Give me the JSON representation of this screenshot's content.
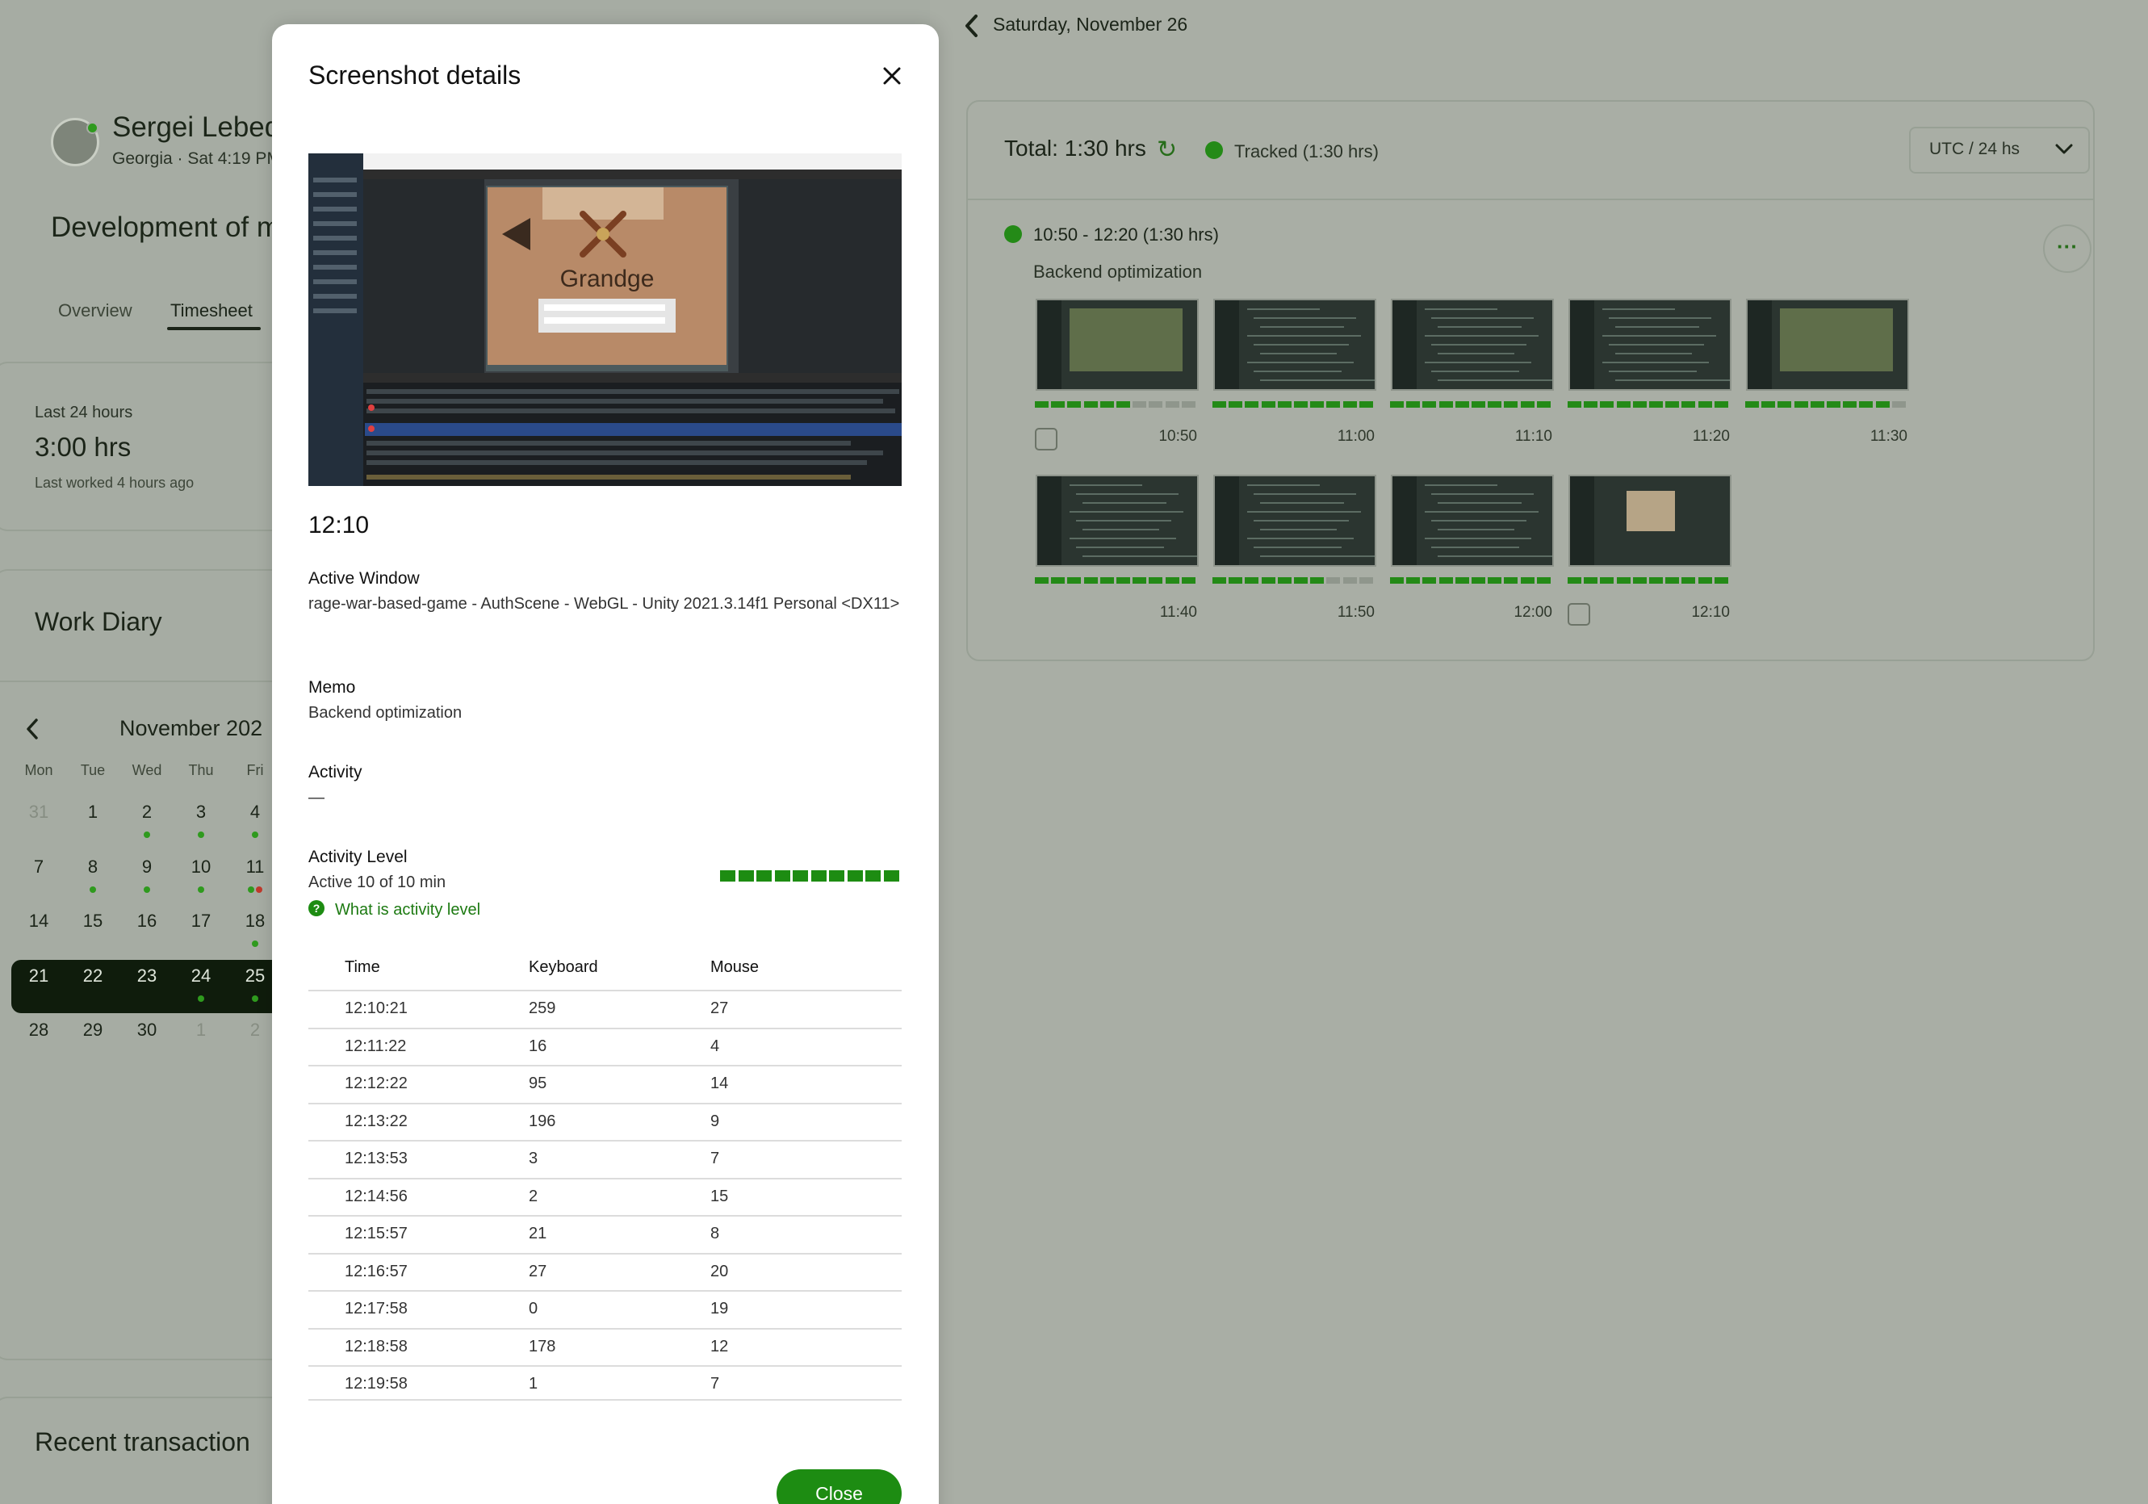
{
  "profile": {
    "name": "Sergei Lebed",
    "meta": "Georgia · Sat 4:19 PM",
    "contract_title": "Development of m"
  },
  "tabs": [
    "Overview",
    "Timesheet"
  ],
  "stats": {
    "label": "Last 24 hours",
    "value": "3:00 hrs",
    "sub": "Last worked 4 hours ago"
  },
  "diary": {
    "title": "Work Diary",
    "month": "November 202",
    "weekdays": [
      "Mon",
      "Tue",
      "Wed",
      "Thu",
      "Fri"
    ],
    "weeks": [
      [
        "31",
        "1",
        "2",
        "3",
        "4"
      ],
      [
        "7",
        "8",
        "9",
        "10",
        "11"
      ],
      [
        "14",
        "15",
        "16",
        "17",
        "18"
      ],
      [
        "21",
        "22",
        "23",
        "24",
        "25"
      ],
      [
        "28",
        "29",
        "30",
        "1",
        "2"
      ]
    ]
  },
  "recent_transactions": "Recent transaction",
  "day": {
    "title": "Saturday, November 26",
    "total": "Total: 1:30 hrs",
    "tracked": "Tracked (1:30 hrs)",
    "timezone": "UTC / 24 hs",
    "segment_time": "10:50 - 12:20 (1:30 hrs)",
    "segment_memo": "Backend optimization",
    "thumbnails": [
      {
        "time": "10:50",
        "activity": 6,
        "kind": "game"
      },
      {
        "time": "11:00",
        "activity": 10,
        "kind": "code"
      },
      {
        "time": "11:10",
        "activity": 10,
        "kind": "code"
      },
      {
        "time": "11:20",
        "activity": 10,
        "kind": "code"
      },
      {
        "time": "11:30",
        "activity": 9,
        "kind": "game"
      },
      {
        "time": "11:40",
        "activity": 10,
        "kind": "code"
      },
      {
        "time": "11:50",
        "activity": 7,
        "kind": "code"
      },
      {
        "time": "12:00",
        "activity": 10,
        "kind": "code"
      },
      {
        "time": "12:10",
        "activity": 10,
        "kind": "card"
      }
    ]
  },
  "modal": {
    "title": "Screenshot details",
    "shot_caption": "Grandge",
    "time": "12:10",
    "active_window_label": "Active Window",
    "active_window": "rage-war-based-game - AuthScene - WebGL - Unity 2021.3.14f1 Personal <DX11>",
    "memo_label": "Memo",
    "memo": "Backend optimization",
    "activity_label": "Activity",
    "activity": "—",
    "activity_level_label": "Activity Level",
    "activity_level": "Active 10 of 10 min",
    "activity_level_value": 10,
    "help_link": "What is activity level",
    "table": {
      "headers": [
        "Time",
        "Keyboard",
        "Mouse"
      ],
      "rows": [
        [
          "12:10:21",
          "259",
          "27"
        ],
        [
          "12:11:22",
          "16",
          "4"
        ],
        [
          "12:12:22",
          "95",
          "14"
        ],
        [
          "12:13:22",
          "196",
          "9"
        ],
        [
          "12:13:53",
          "3",
          "7"
        ],
        [
          "12:14:56",
          "2",
          "15"
        ],
        [
          "12:15:57",
          "21",
          "8"
        ],
        [
          "12:16:57",
          "27",
          "20"
        ],
        [
          "12:17:58",
          "0",
          "19"
        ],
        [
          "12:18:58",
          "178",
          "12"
        ],
        [
          "12:19:58",
          "1",
          "7"
        ]
      ]
    },
    "close_button": "Close"
  },
  "colors": {
    "accent": "#1d8c12",
    "overlay_bg": "#a9aea5",
    "selected_week": "#0f1c0c"
  }
}
